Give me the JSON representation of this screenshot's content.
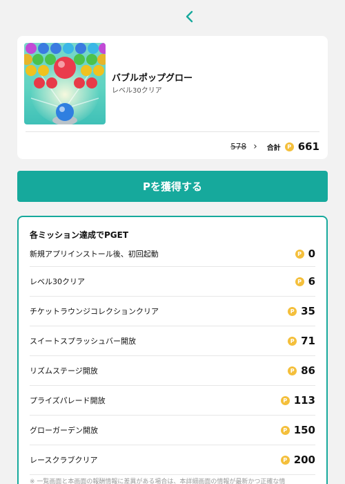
{
  "nav": {
    "back_icon": "chevron-left-icon",
    "accent": "#16a99c"
  },
  "game": {
    "title": "バブルポップグロー",
    "subtitle": "レベル30クリア",
    "image_desc_icon": "bubble-game-thumbnail"
  },
  "points": {
    "old": "578",
    "total_label": "合計",
    "total": "661",
    "coin_symbol": "P",
    "coin_color": "#f4bf3b"
  },
  "cta": {
    "label": "Pを獲得する",
    "color": "#16a99c"
  },
  "missions": {
    "header": "各ミッション達成でPGET",
    "items": [
      {
        "label": "新規アプリインストール後、初回起動",
        "points": "0"
      },
      {
        "label": "レベル30クリア",
        "points": "6"
      },
      {
        "label": "チケットラウンジコレクションクリア",
        "points": "35"
      },
      {
        "label": "スイートスプラッシュバー開放",
        "points": "71"
      },
      {
        "label": "リズムステージ開放",
        "points": "86"
      },
      {
        "label": "プライズパレード開放",
        "points": "113"
      },
      {
        "label": "グローガーデン開放",
        "points": "150"
      },
      {
        "label": "レースクラブクリア",
        "points": "200"
      }
    ],
    "note": "※ 一覧画面と本画面の報酬情報に差異がある場合は、本詳細画面の情報が最新かつ正確な情"
  }
}
